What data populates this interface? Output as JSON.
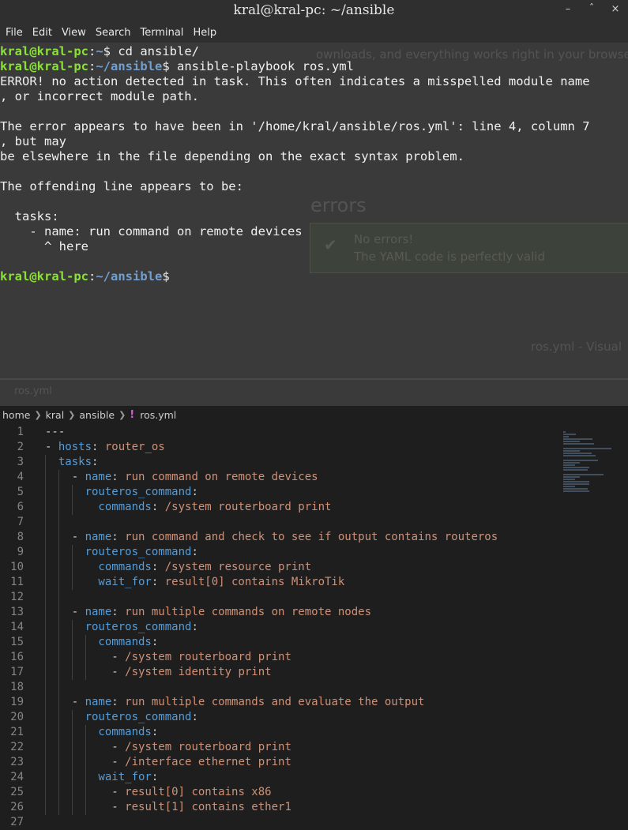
{
  "terminal": {
    "title": "kral@kral-pc: ~/ansible",
    "menu": [
      "File",
      "Edit",
      "View",
      "Search",
      "Terminal",
      "Help"
    ],
    "lines": [
      [
        {
          "t": "kral@kral-pc",
          "c": "pu"
        },
        {
          "t": ":",
          "c": "pw"
        },
        {
          "t": "~",
          "c": "pp"
        },
        {
          "t": "$ cd ansible/",
          "c": "pw"
        }
      ],
      [
        {
          "t": "kral@kral-pc",
          "c": "pu"
        },
        {
          "t": ":",
          "c": "pw"
        },
        {
          "t": "~/ansible",
          "c": "pp"
        },
        {
          "t": "$ ansible-playbook ros.yml",
          "c": "pw"
        }
      ],
      [
        {
          "t": "ERROR! no action detected in task. This often indicates a misspelled module name",
          "c": "pw"
        }
      ],
      [
        {
          "t": ", or incorrect module path.",
          "c": "pw"
        }
      ],
      [
        {
          "t": "",
          "c": "pw"
        }
      ],
      [
        {
          "t": "The error appears to have been in '/home/kral/ansible/ros.yml': line 4, column 7",
          "c": "pw"
        }
      ],
      [
        {
          "t": ", but may",
          "c": "pw"
        }
      ],
      [
        {
          "t": "be elsewhere in the file depending on the exact syntax problem.",
          "c": "pw"
        }
      ],
      [
        {
          "t": "",
          "c": "pw"
        }
      ],
      [
        {
          "t": "The offending line appears to be:",
          "c": "pw"
        }
      ],
      [
        {
          "t": "",
          "c": "pw"
        }
      ],
      [
        {
          "t": "  tasks:",
          "c": "pw"
        }
      ],
      [
        {
          "t": "    - name: run command on remote devices",
          "c": "pw"
        }
      ],
      [
        {
          "t": "      ^ here",
          "c": "pw"
        }
      ],
      [
        {
          "t": "",
          "c": "pw"
        }
      ],
      [
        {
          "t": "kral@kral-pc",
          "c": "pu"
        },
        {
          "t": ":",
          "c": "pw"
        },
        {
          "t": "~/ansible",
          "c": "pp"
        },
        {
          "t": "$",
          "c": "pw"
        }
      ]
    ]
  },
  "editor": {
    "breadcrumb": [
      "home",
      "kral",
      "ansible"
    ],
    "file_icon": "!",
    "file_name": "ros.yml",
    "lines": [
      {
        "n": "1",
        "indent": 0,
        "tokens": [
          {
            "t": "---",
            "c": "p"
          }
        ]
      },
      {
        "n": "2",
        "indent": 0,
        "tokens": [
          {
            "t": "- ",
            "c": "p"
          },
          {
            "t": "hosts",
            "c": "k"
          },
          {
            "t": ": ",
            "c": "p"
          },
          {
            "t": "router_os",
            "c": "v"
          }
        ]
      },
      {
        "n": "3",
        "indent": 1,
        "tokens": [
          {
            "t": "  tasks",
            "c": "k"
          },
          {
            "t": ":",
            "c": "p"
          }
        ]
      },
      {
        "n": "4",
        "indent": 2,
        "tokens": [
          {
            "t": "    - ",
            "c": "p"
          },
          {
            "t": "name",
            "c": "k"
          },
          {
            "t": ": ",
            "c": "p"
          },
          {
            "t": "run command on remote devices",
            "c": "v"
          }
        ]
      },
      {
        "n": "5",
        "indent": 3,
        "tokens": [
          {
            "t": "      routeros_command",
            "c": "k"
          },
          {
            "t": ":",
            "c": "p"
          }
        ]
      },
      {
        "n": "6",
        "indent": 3,
        "tokens": [
          {
            "t": "        commands",
            "c": "k"
          },
          {
            "t": ": ",
            "c": "p"
          },
          {
            "t": "/system routerboard print",
            "c": "v"
          }
        ]
      },
      {
        "n": "7",
        "indent": 2,
        "tokens": []
      },
      {
        "n": "8",
        "indent": 2,
        "tokens": [
          {
            "t": "    - ",
            "c": "p"
          },
          {
            "t": "name",
            "c": "k"
          },
          {
            "t": ": ",
            "c": "p"
          },
          {
            "t": "run command and check to see if output contains routeros",
            "c": "v"
          }
        ]
      },
      {
        "n": "9",
        "indent": 3,
        "tokens": [
          {
            "t": "      routeros_command",
            "c": "k"
          },
          {
            "t": ":",
            "c": "p"
          }
        ]
      },
      {
        "n": "10",
        "indent": 3,
        "tokens": [
          {
            "t": "        commands",
            "c": "k"
          },
          {
            "t": ": ",
            "c": "p"
          },
          {
            "t": "/system resource print",
            "c": "v"
          }
        ]
      },
      {
        "n": "11",
        "indent": 3,
        "tokens": [
          {
            "t": "        wait_for",
            "c": "k"
          },
          {
            "t": ": ",
            "c": "p"
          },
          {
            "t": "result[0] contains MikroTik",
            "c": "v"
          }
        ]
      },
      {
        "n": "12",
        "indent": 2,
        "tokens": []
      },
      {
        "n": "13",
        "indent": 2,
        "tokens": [
          {
            "t": "    - ",
            "c": "p"
          },
          {
            "t": "name",
            "c": "k"
          },
          {
            "t": ": ",
            "c": "p"
          },
          {
            "t": "run multiple commands on remote nodes",
            "c": "v"
          }
        ]
      },
      {
        "n": "14",
        "indent": 3,
        "tokens": [
          {
            "t": "      routeros_command",
            "c": "k"
          },
          {
            "t": ":",
            "c": "p"
          }
        ]
      },
      {
        "n": "15",
        "indent": 4,
        "tokens": [
          {
            "t": "        commands",
            "c": "k"
          },
          {
            "t": ":",
            "c": "p"
          }
        ]
      },
      {
        "n": "16",
        "indent": 4,
        "tokens": [
          {
            "t": "          - ",
            "c": "p"
          },
          {
            "t": "/system routerboard print",
            "c": "v"
          }
        ]
      },
      {
        "n": "17",
        "indent": 4,
        "tokens": [
          {
            "t": "          - ",
            "c": "p"
          },
          {
            "t": "/system identity print",
            "c": "v"
          }
        ]
      },
      {
        "n": "18",
        "indent": 2,
        "tokens": []
      },
      {
        "n": "19",
        "indent": 2,
        "tokens": [
          {
            "t": "    - ",
            "c": "p"
          },
          {
            "t": "name",
            "c": "k"
          },
          {
            "t": ": ",
            "c": "p"
          },
          {
            "t": "run multiple commands and evaluate the output",
            "c": "v"
          }
        ]
      },
      {
        "n": "20",
        "indent": 3,
        "tokens": [
          {
            "t": "      routeros_command",
            "c": "k"
          },
          {
            "t": ":",
            "c": "p"
          }
        ]
      },
      {
        "n": "21",
        "indent": 4,
        "tokens": [
          {
            "t": "        commands",
            "c": "k"
          },
          {
            "t": ":",
            "c": "p"
          }
        ]
      },
      {
        "n": "22",
        "indent": 4,
        "tokens": [
          {
            "t": "          - ",
            "c": "p"
          },
          {
            "t": "/system routerboard print",
            "c": "v"
          }
        ]
      },
      {
        "n": "23",
        "indent": 4,
        "tokens": [
          {
            "t": "          - ",
            "c": "p"
          },
          {
            "t": "/interface ethernet print",
            "c": "v"
          }
        ]
      },
      {
        "n": "24",
        "indent": 4,
        "tokens": [
          {
            "t": "        wait_for",
            "c": "k"
          },
          {
            "t": ":",
            "c": "p"
          }
        ]
      },
      {
        "n": "25",
        "indent": 4,
        "tokens": [
          {
            "t": "          - ",
            "c": "p"
          },
          {
            "t": "result[0] contains x86",
            "c": "v"
          }
        ]
      },
      {
        "n": "26",
        "indent": 4,
        "tokens": [
          {
            "t": "          - ",
            "c": "p"
          },
          {
            "t": "result[1] contains ether1",
            "c": "v"
          }
        ]
      },
      {
        "n": "27",
        "indent": 0,
        "tokens": []
      }
    ]
  },
  "ghost": {
    "banner": "ownloads, and everything works right in your browser. Made for develope",
    "heading": "errors",
    "success_title": "No errors!",
    "success_body": "The YAML code is perfectly valid",
    "tab": "ros.yml - Visual",
    "tab_file": "ros.yml"
  }
}
